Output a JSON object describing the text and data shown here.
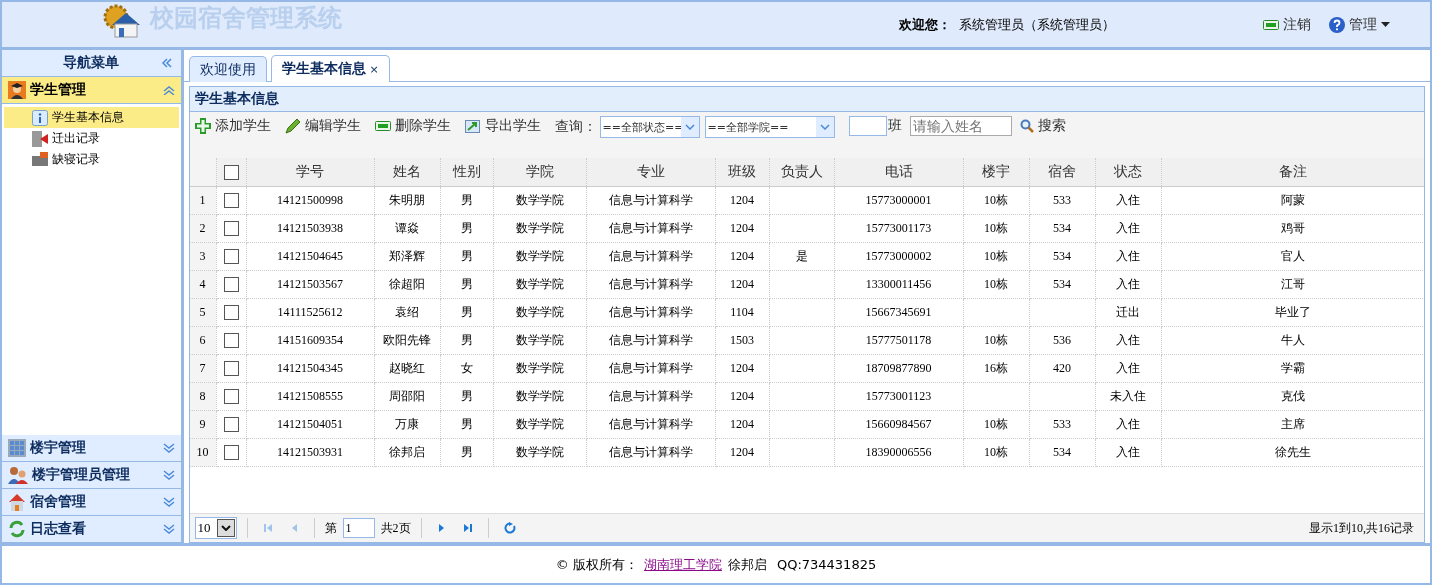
{
  "header": {
    "title": "校园宿舍管理系统",
    "welcome_label": "欢迎您：",
    "user": "系统管理员（系统管理员）",
    "logout": "注销",
    "admin_menu": "管理"
  },
  "sidebar": {
    "title": "导航菜单",
    "sections": [
      {
        "label": "学生管理",
        "expanded": true,
        "selected": true,
        "items": [
          {
            "label": "学生基本信息",
            "selected": true
          },
          {
            "label": "迁出记录",
            "selected": false
          },
          {
            "label": "缺寝记录",
            "selected": false
          }
        ]
      },
      {
        "label": "楼宇管理",
        "expanded": false,
        "selected": false
      },
      {
        "label": "楼宇管理员管理",
        "expanded": false,
        "selected": false
      },
      {
        "label": "宿舍管理",
        "expanded": false,
        "selected": false
      },
      {
        "label": "日志查看",
        "expanded": false,
        "selected": false
      }
    ]
  },
  "tabs": [
    {
      "label": "欢迎使用",
      "selected": false
    },
    {
      "label": "学生基本信息",
      "selected": true,
      "close": "×"
    }
  ],
  "panel": {
    "title": "学生基本信息",
    "toolbar": {
      "buttons": [
        "添加学生",
        "编辑学生",
        "删除学生",
        "导出学生"
      ],
      "query_label": "查询：",
      "status_select": "==全部状态==",
      "college_select": "==全部学院==",
      "class_label": "班",
      "name_placeholder": "请输入姓名",
      "search": "搜索"
    },
    "table": {
      "header_checked": false,
      "columns": [
        "学号",
        "姓名",
        "性别",
        "学院",
        "专业",
        "班级",
        "负责人",
        "电话",
        "楼宇",
        "宿舍",
        "状态",
        "备注"
      ],
      "rows": [
        {
          "index": "1",
          "checked": false,
          "cells": [
            "14121500998",
            "朱明朋",
            "男",
            "数学学院",
            "信息与计算科学",
            "1204",
            "",
            "15773000001",
            "10栋",
            "533",
            "入住",
            "阿蒙"
          ]
        },
        {
          "index": "2",
          "checked": false,
          "cells": [
            "14121503938",
            "谭焱",
            "男",
            "数学学院",
            "信息与计算科学",
            "1204",
            "",
            "15773001173",
            "10栋",
            "534",
            "入住",
            "鸡哥"
          ]
        },
        {
          "index": "3",
          "checked": false,
          "cells": [
            "14121504645",
            "郑泽辉",
            "男",
            "数学学院",
            "信息与计算科学",
            "1204",
            "是",
            "15773000002",
            "10栋",
            "534",
            "入住",
            "官人"
          ]
        },
        {
          "index": "4",
          "checked": false,
          "cells": [
            "14121503567",
            "徐超阳",
            "男",
            "数学学院",
            "信息与计算科学",
            "1204",
            "",
            "13300011456",
            "10栋",
            "534",
            "入住",
            "江哥"
          ]
        },
        {
          "index": "5",
          "checked": false,
          "cells": [
            "14111525612",
            "袁绍",
            "男",
            "数学学院",
            "信息与计算科学",
            "1104",
            "",
            "15667345691",
            "",
            "",
            "迁出",
            "毕业了"
          ]
        },
        {
          "index": "6",
          "checked": false,
          "cells": [
            "14151609354",
            "欧阳先锋",
            "男",
            "数学学院",
            "信息与计算科学",
            "1503",
            "",
            "15777501178",
            "10栋",
            "536",
            "入住",
            "牛人"
          ]
        },
        {
          "index": "7",
          "checked": false,
          "cells": [
            "14121504345",
            "赵晓红",
            "女",
            "数学学院",
            "信息与计算科学",
            "1204",
            "",
            "18709877890",
            "16栋",
            "420",
            "入住",
            "学霸"
          ]
        },
        {
          "index": "8",
          "checked": false,
          "cells": [
            "14121508555",
            "周邵阳",
            "男",
            "数学学院",
            "信息与计算科学",
            "1204",
            "",
            "15773001123",
            "",
            "",
            "未入住",
            "克伐"
          ]
        },
        {
          "index": "9",
          "checked": false,
          "cells": [
            "14121504051",
            "万康",
            "男",
            "数学学院",
            "信息与计算科学",
            "1204",
            "",
            "15660984567",
            "10栋",
            "533",
            "入住",
            "主席"
          ]
        },
        {
          "index": "10",
          "checked": false,
          "cells": [
            "14121503931",
            "徐邦启",
            "男",
            "数学学院",
            "信息与计算科学",
            "1204",
            "",
            "18390006556",
            "10栋",
            "534",
            "入住",
            "徐先生"
          ]
        }
      ]
    },
    "pager": {
      "page_size": "10",
      "page_label": "第",
      "page": "1",
      "total_pages": "共2页",
      "summary": "显示1到10,共16记录"
    }
  },
  "footer": {
    "copyright": "© 版权所有：",
    "school_link": "湖南理工学院",
    "author": "徐邦启",
    "qq": "QQ:734431825"
  }
}
